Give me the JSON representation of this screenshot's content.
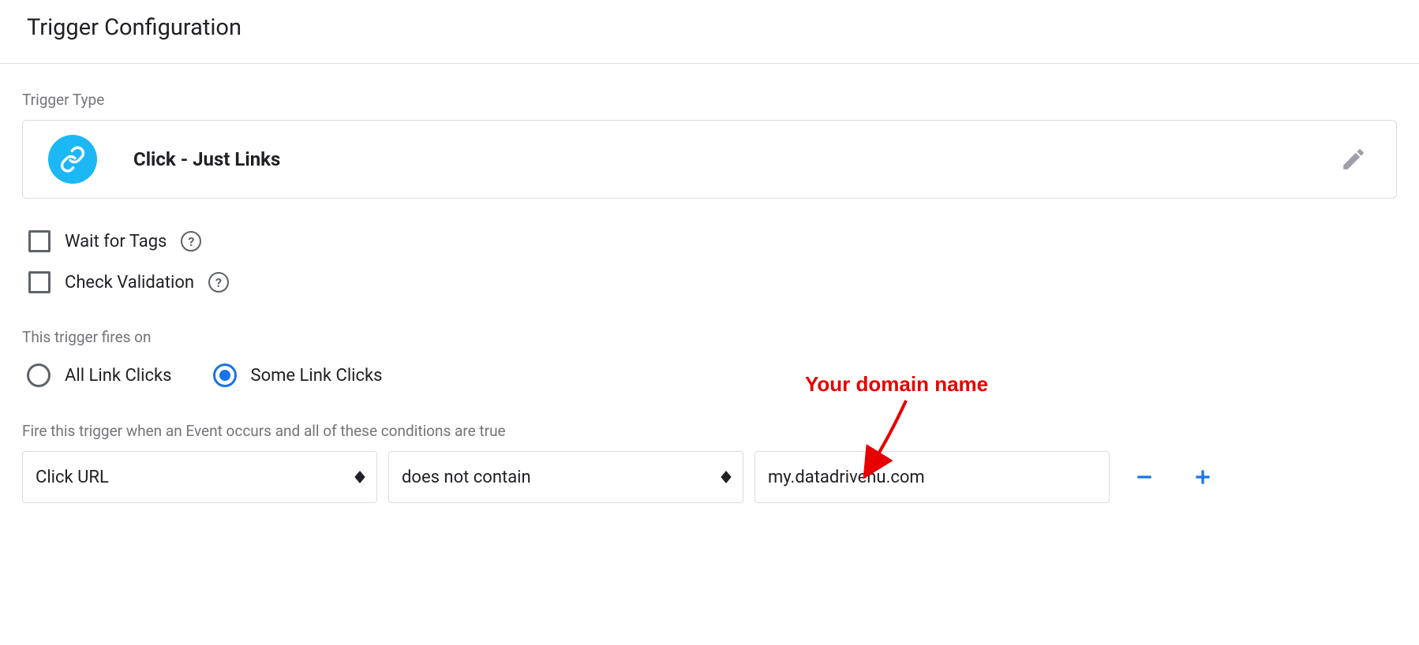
{
  "header": {
    "title": "Trigger Configuration"
  },
  "trigger_type": {
    "label": "Trigger Type",
    "name": "Click - Just Links"
  },
  "options": {
    "wait_for_tags": "Wait for Tags",
    "check_validation": "Check Validation"
  },
  "fires_on": {
    "label": "This trigger fires on",
    "all": "All Link Clicks",
    "some": "Some Link Clicks"
  },
  "condition": {
    "label": "Fire this trigger when an Event occurs and all of these conditions are true",
    "variable": "Click URL",
    "operator": "does not contain",
    "value": "my.datadrivenu.com"
  },
  "annotation": {
    "text": "Your domain name"
  }
}
